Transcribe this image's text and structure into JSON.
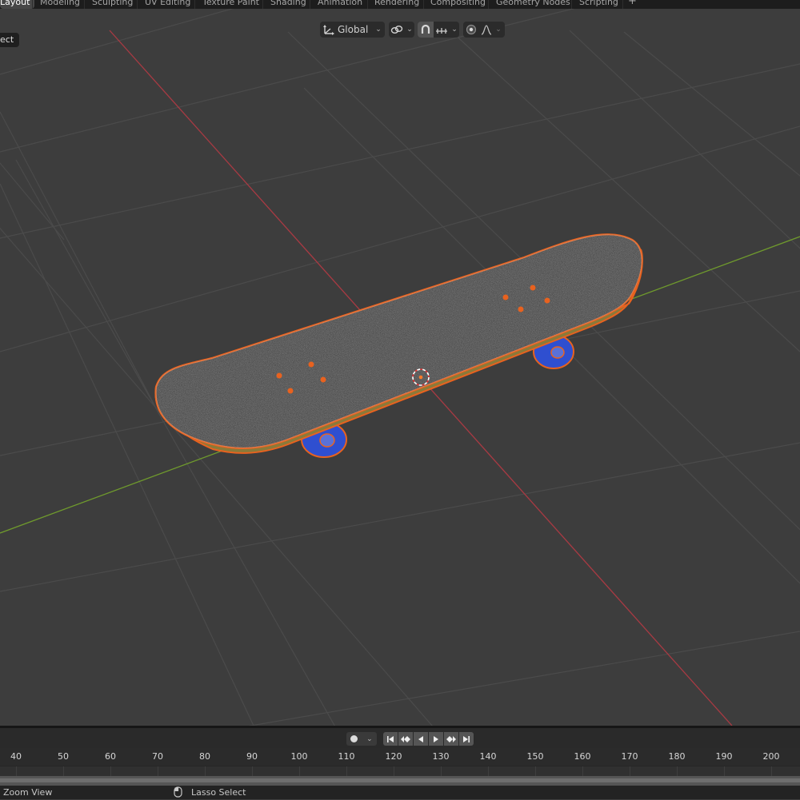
{
  "workspace_tabs": [
    {
      "label": "Layout",
      "active": true
    },
    {
      "label": "Modeling",
      "active": false
    },
    {
      "label": "Sculpting",
      "active": false
    },
    {
      "label": "UV Editing",
      "active": false
    },
    {
      "label": "Texture Paint",
      "active": false
    },
    {
      "label": "Shading",
      "active": false
    },
    {
      "label": "Animation",
      "active": false
    },
    {
      "label": "Rendering",
      "active": false
    },
    {
      "label": "Compositing",
      "active": false
    },
    {
      "label": "Geometry Nodes",
      "active": false
    },
    {
      "label": "Scripting",
      "active": false
    }
  ],
  "add_workspace_label": "+",
  "viewport_header": {
    "transform_orientation": "Global",
    "pivot_icon": "linked-chain-icon",
    "snap_icon": "magnet-icon",
    "snap_increment_icon": "snap-increment-icon",
    "proportional_icon": "proportional-edit-icon",
    "falloff_icon": "falloff-curve-icon"
  },
  "select_mode_label": "ect",
  "scene": {
    "object": "skateboard",
    "selection_outline_color": "#e8621f",
    "grip_color": "#3b3b3b",
    "wheel_color": "#2f4fd0",
    "x_axis_color": "#a93a43",
    "y_axis_color": "#6f9a2d"
  },
  "timeline": {
    "ruler_labels": [
      "40",
      "50",
      "60",
      "70",
      "80",
      "90",
      "100",
      "110",
      "120",
      "130",
      "140",
      "150",
      "160",
      "170",
      "180",
      "190",
      "200"
    ],
    "keying_icon": "record-keyframe-icon",
    "playback_icons": [
      "jump-to-start-icon",
      "prev-keyframe-icon",
      "play-reverse-icon",
      "play-icon",
      "next-keyframe-icon",
      "jump-to-end-icon"
    ]
  },
  "status_bar": {
    "left_hint": "Zoom View",
    "mid_hint": "Lasso Select"
  }
}
